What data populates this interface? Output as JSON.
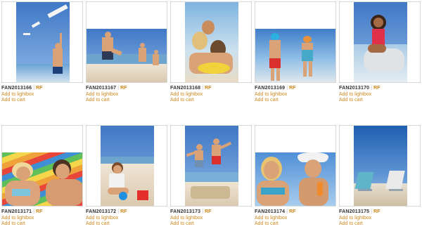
{
  "items": [
    {
      "code": "FAN2013166",
      "license": "RF",
      "lightbox": "Add to lightbox",
      "cart": "Add to cart"
    },
    {
      "code": "FAN2013167",
      "license": "RF",
      "lightbox": "Add to lightbox",
      "cart": "Add to cart"
    },
    {
      "code": "FAN2013168",
      "license": "RF",
      "lightbox": "Add to lightbox",
      "cart": "Add to cart"
    },
    {
      "code": "FAN2013169",
      "license": "RF",
      "lightbox": "Add to lightbox",
      "cart": "Add to cart"
    },
    {
      "code": "FAN2013170",
      "license": "RF",
      "lightbox": "Add to lightbox",
      "cart": "Add to cart"
    },
    {
      "code": "FAN2013171",
      "license": "RF",
      "lightbox": "Add to lightbox",
      "cart": "Add to cart"
    },
    {
      "code": "FAN2013172",
      "license": "RF",
      "lightbox": "Add to lightbox",
      "cart": "Add to cart"
    },
    {
      "code": "FAN2013173",
      "license": "RF",
      "lightbox": "Add to lightbox",
      "cart": "Add to cart"
    },
    {
      "code": "FAN2013174",
      "license": "RF",
      "lightbox": "Add to lightbox",
      "cart": "Add to cart"
    },
    {
      "code": "FAN2013175",
      "license": "RF",
      "lightbox": "Add to lightbox",
      "cart": "Add to cart"
    }
  ],
  "separator": "|",
  "colors": {
    "link": "#cc8a1e",
    "code": "#333333",
    "border": "#d9d9d9"
  }
}
